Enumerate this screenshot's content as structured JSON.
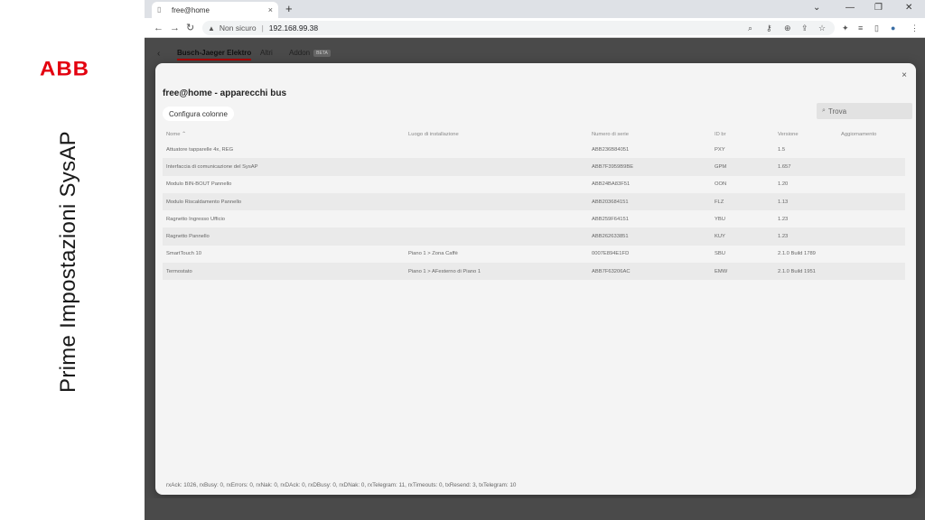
{
  "brand": {
    "logo_text": "ABB",
    "side_title": "Prime Impostazioni SysAP",
    "logo_color": "#e3000f"
  },
  "browser": {
    "tab_title": "free@home",
    "tab_close": "×",
    "new_tab": "+",
    "security_label": "Non sicuro",
    "url": "192.168.99.38",
    "window_controls": [
      "⌄",
      "—",
      "❐",
      "✕"
    ]
  },
  "page_tabs": {
    "items": [
      "Busch-Jaeger Elektro",
      "Altri",
      "Addon"
    ],
    "active": 0,
    "beta_badge": "BETA"
  },
  "modal": {
    "title": "free@home - apparecchi bus",
    "configure_button": "Configura colonne",
    "search_placeholder": "Trova",
    "close": "×",
    "columns": [
      "Nome ⌃",
      "Luogo di installazione",
      "Numero di serie",
      "ID br",
      "Versione",
      "Aggiornamento"
    ],
    "rows": [
      {
        "name": "Attuatore tapparelle 4x, REG",
        "location": "",
        "serial": "ABB236B84051",
        "id": "PXY",
        "version": "1.5",
        "update": ""
      },
      {
        "name": "Interfaccia di comunicazione del SysAP",
        "location": "",
        "serial": "ABB7F3959B9BE",
        "id": "GPM",
        "version": "1.657",
        "update": ""
      },
      {
        "name": "Modulo BIN-BOUT Pannello",
        "location": "",
        "serial": "ABB24BA83F51",
        "id": "OON",
        "version": "1.20",
        "update": ""
      },
      {
        "name": "Modulo Riscaldamento Pannello",
        "location": "",
        "serial": "ABB203684151",
        "id": "FLZ",
        "version": "1.13",
        "update": ""
      },
      {
        "name": "Ragnetto Ingresso Ufficio",
        "location": "",
        "serial": "ABB259F64151",
        "id": "YBU",
        "version": "1.23",
        "update": ""
      },
      {
        "name": "Ragnetto Pannello",
        "location": "",
        "serial": "ABB262633851",
        "id": "KUY",
        "version": "1.23",
        "update": ""
      },
      {
        "name": "SmartTouch 10",
        "location": "Piano 1 > Zona Caffè",
        "serial": "0007E894E1FD",
        "id": "SBU",
        "version": "2.1.0 Build 1789",
        "update": ""
      },
      {
        "name": "Termostato",
        "location": "Piano 1 > AFesterno di Piano 1",
        "serial": "ABB7F63206AC",
        "id": "EMW",
        "version": "2.1.0 Build 1951",
        "update": ""
      }
    ],
    "status_line": "rxAck: 1026, rxBusy: 0, rxErrors: 0, rxNak: 0, rxDAck: 0, rxDBusy: 0, rxDNak: 0, rxTelegram: 11, rxTimeouts: 0, txResend: 3, txTelegram: 10"
  },
  "icons": {
    "back": "←",
    "forward": "→",
    "reload": "↻",
    "warning": "▲",
    "search": "⌕",
    "key": "⚷",
    "zoom": "⊕",
    "share": "⇪",
    "star": "☆",
    "extensions": "✦",
    "media": "≡",
    "sidepanel": "▯",
    "profile": "●",
    "menu": "⋮",
    "favicon": "▯",
    "page_back": "‹"
  }
}
